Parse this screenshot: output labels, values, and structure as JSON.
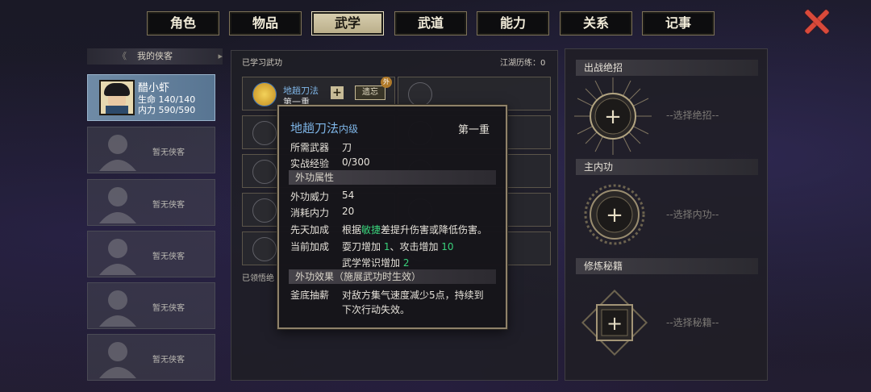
{
  "tabs": [
    {
      "label": "角色",
      "active": false
    },
    {
      "label": "物品",
      "active": false
    },
    {
      "label": "武学",
      "active": true
    },
    {
      "label": "武道",
      "active": false
    },
    {
      "label": "能力",
      "active": false
    },
    {
      "label": "关系",
      "active": false
    },
    {
      "label": "记事",
      "active": false
    }
  ],
  "left": {
    "header": "我的侠客",
    "selected": {
      "name": "醋小虾",
      "hp": "生命 140/140",
      "mp": "内力 590/590"
    },
    "empty_label": "暂无侠客"
  },
  "middle": {
    "title": "已学习武功",
    "jianghu": "江湖历练：0",
    "skill": {
      "name": "地趟刀法",
      "level": "第一重",
      "forget": "遗忘",
      "badge": "外",
      "add": "+"
    },
    "footer": "已领悟绝"
  },
  "tooltip": {
    "name": "地趟刀法",
    "grade": "内级",
    "level": "第一重",
    "weapon_k": "所需武器",
    "weapon_v": "刀",
    "exp_k": "实战经验",
    "exp_v": "0/300",
    "sec1": "外功属性",
    "power_k": "外功威力",
    "power_v": "54",
    "cost_k": "消耗内力",
    "cost_v": "20",
    "innate_k": "先天加成",
    "innate_a": "根据",
    "innate_b": "敏捷",
    "innate_c": "差提升伤害或降低伤害。",
    "cur_k": "当前加成",
    "cur_a": "耍刀增加 ",
    "cur_b": "1",
    "cur_c": "、攻击增加 ",
    "cur_d": "10",
    "cur2_a": "武学常识增加 ",
    "cur2_b": "2",
    "sec2": "外功效果（施展武功时生效）",
    "eff_k": "釜底抽薪",
    "eff_v1": "对敌方集气速度减少5点，持续到",
    "eff_v2": "下次行动失效。"
  },
  "right": {
    "s1": {
      "title": "出战绝招",
      "hint": "--选择绝招--"
    },
    "s2": {
      "title": "主内功",
      "hint": "--选择内功--"
    },
    "s3": {
      "title": "修炼秘籍",
      "hint": "--选择秘籍--"
    },
    "plus": "+"
  },
  "colors": {
    "accent_blue": "#7fb6e8",
    "green": "#39d07a",
    "close_red": "#d9493a"
  }
}
